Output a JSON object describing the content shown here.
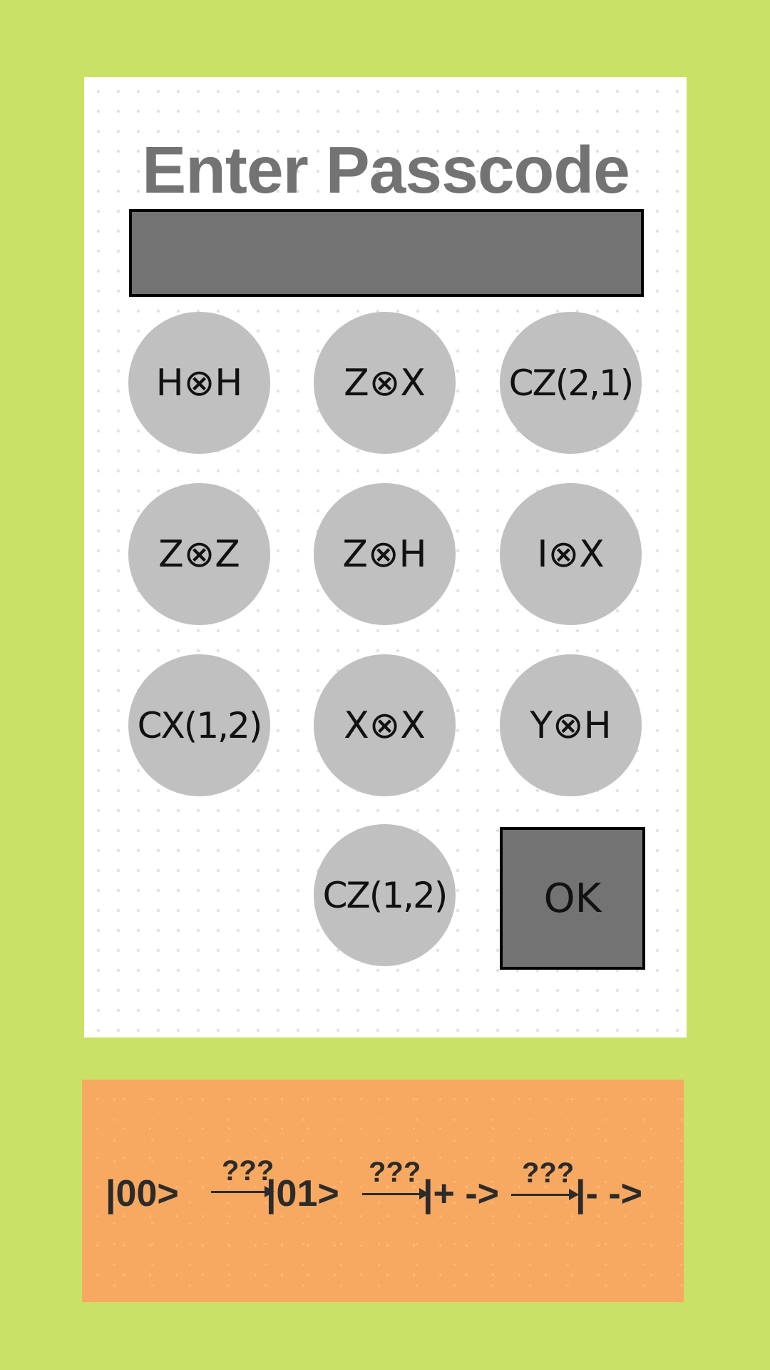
{
  "colors": {
    "background": "#c9e265",
    "panel": "#ffffff",
    "key": "#c0c0c0",
    "display": "#737373",
    "title": "#737373",
    "hint_box": "#f8a961",
    "text": "#111111"
  },
  "title": "Enter Passcode",
  "display_value": "",
  "keypad": {
    "keys": [
      {
        "label": "H⊗H"
      },
      {
        "label": "Z⊗X"
      },
      {
        "label": "CZ(2,1)"
      },
      {
        "label": "Z⊗Z"
      },
      {
        "label": "Z⊗H"
      },
      {
        "label": "I⊗X"
      },
      {
        "label": "CX(1,2)"
      },
      {
        "label": "X⊗X"
      },
      {
        "label": "Y⊗H"
      },
      {
        "label": "CZ(1,2)"
      }
    ],
    "ok_label": "OK"
  },
  "hint": {
    "states": [
      "|00>",
      "|01>",
      "|+ ->",
      "|- ->"
    ],
    "operators": [
      "???",
      "???",
      "???"
    ],
    "icons": [
      "arrow-icon",
      "arrow-icon",
      "arrow-icon"
    ]
  }
}
